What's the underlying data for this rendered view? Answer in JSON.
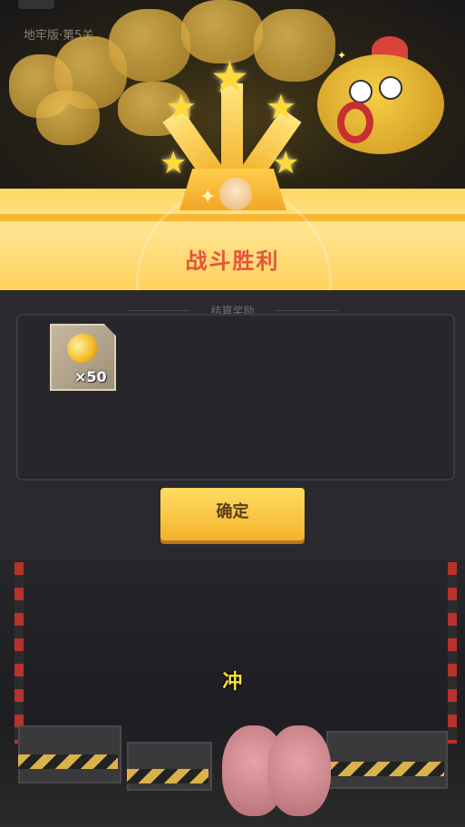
{
  "game": {
    "level_label": "地牢版·第5关"
  },
  "result": {
    "title": "战斗胜利",
    "reward_header": "结算奖励",
    "rewards": [
      {
        "icon": "gold-coin-icon",
        "count_label": "×50"
      }
    ],
    "confirm_label": "确定"
  },
  "subtitle": "冲",
  "colors": {
    "banner": "#ffd865",
    "title": "#e4553b",
    "button": "#f4b329",
    "subtitle": "#ffdf2f"
  }
}
